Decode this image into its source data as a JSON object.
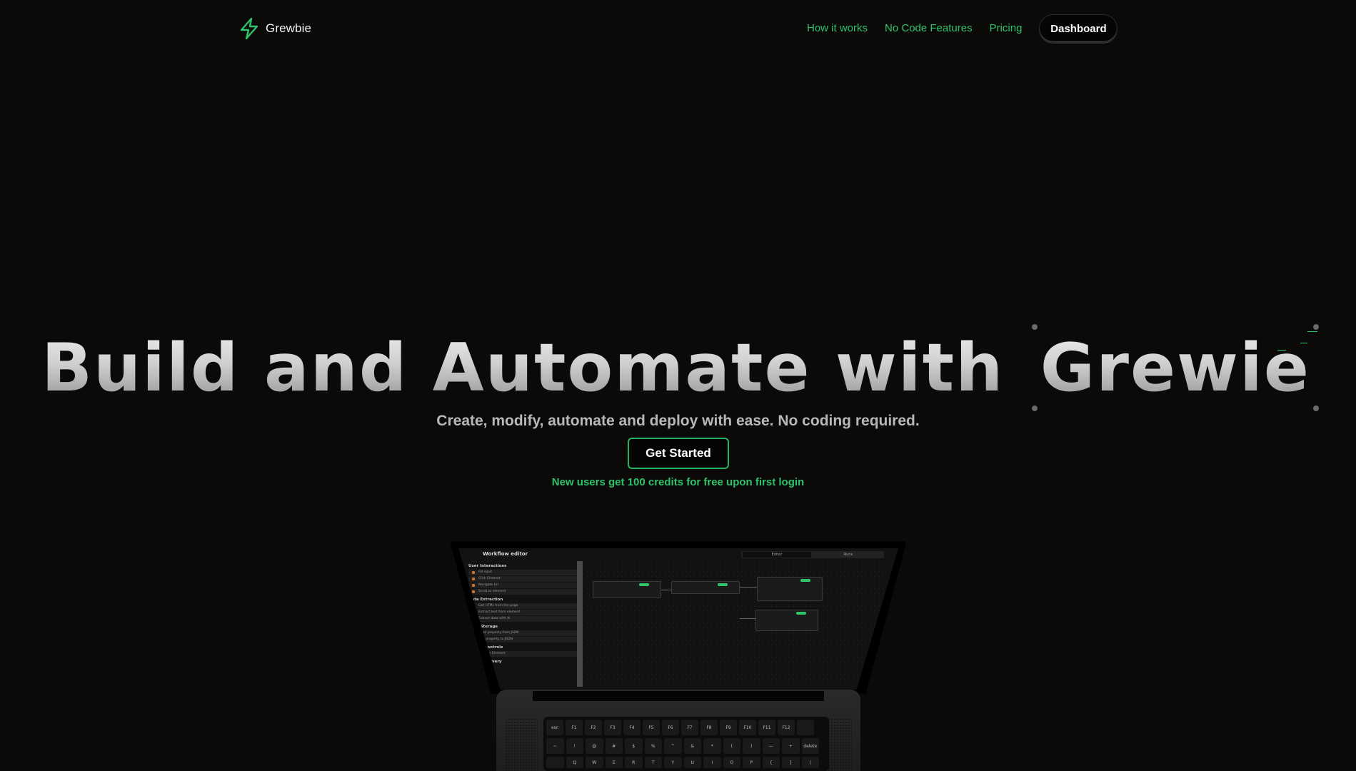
{
  "nav": {
    "brand": "Grewbie",
    "links": [
      "How it works",
      "No Code Features",
      "Pricing"
    ],
    "dashboard_label": "Dashboard"
  },
  "hero": {
    "title_part1": "Build and Automate with",
    "title_highlight": "Grewie",
    "subtitle": "Create, modify, automate and deploy with ease. No coding required.",
    "cta_label": "Get Started",
    "credits_note": "New users get 100 credits for free upon first login"
  },
  "laptop_screen": {
    "title": "Workflow editor",
    "tabs": [
      "Editor",
      "Runs"
    ],
    "sections": [
      {
        "name": "User Interactions",
        "items": [
          "Fill input",
          "Click Element",
          "Navigate Url",
          "Scroll to element"
        ]
      },
      {
        "name": "Data Extraction",
        "items": [
          "Get HTML from the page",
          "Extract text from element",
          "Extract data with AI"
        ]
      },
      {
        "name": "Data Storage",
        "items": [
          "Read property from JSON",
          "Add property to JSON"
        ]
      },
      {
        "name": "Timing controls",
        "items": [
          "Wait for Element"
        ]
      },
      {
        "name": "Result delivery",
        "items": []
      }
    ]
  },
  "keyboard": {
    "fn_row": [
      "esc",
      "F1",
      "F2",
      "F3",
      "F4",
      "F5",
      "F6",
      "F7",
      "F8",
      "F9",
      "F10",
      "F11",
      "F12",
      ""
    ],
    "num_row": [
      "~",
      "!",
      "@",
      "#",
      "$",
      "%",
      "^",
      "&",
      "*",
      "(",
      ")",
      "—",
      "+",
      "delete"
    ],
    "alpha_row": [
      "",
      "Q",
      "W",
      "E",
      "R",
      "T",
      "Y",
      "U",
      "I",
      "O",
      "P",
      "{",
      "}",
      "|"
    ]
  },
  "colors": {
    "accent": "#2fc46a",
    "background": "#0b0a09",
    "subtitle": "#b8b8b8"
  },
  "icons": {
    "brand": "lightning-bolt-icon"
  }
}
